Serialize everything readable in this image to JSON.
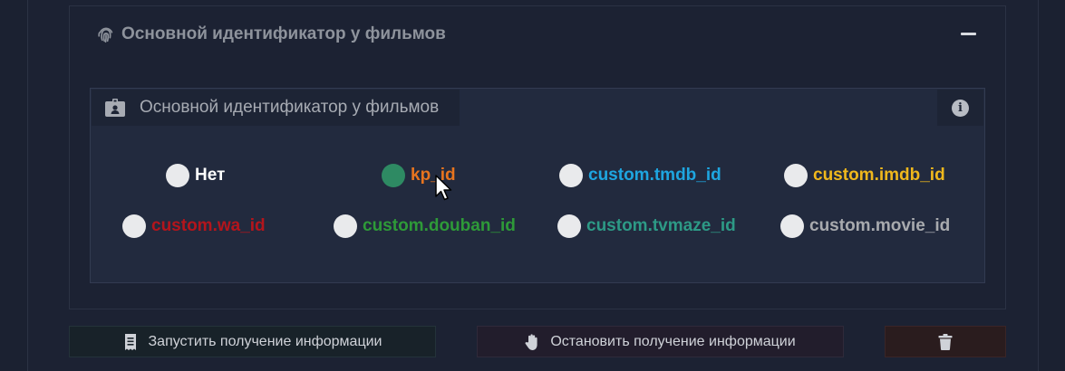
{
  "section": {
    "title": "Основной идентификатор у фильмов"
  },
  "panel": {
    "title": "Основной идентификатор у фильмов",
    "info_icon": "i"
  },
  "options": [
    {
      "label": "Нет",
      "color": "#ffffff",
      "checked": false
    },
    {
      "label": "kp_id",
      "color": "#e8741e",
      "checked": true
    },
    {
      "label": "custom.tmdb_id",
      "color": "#1ea6e0",
      "checked": false
    },
    {
      "label": "custom.imdb_id",
      "color": "#f0b81c",
      "checked": false
    },
    {
      "label": "custom.wa_id",
      "color": "#b3151c",
      "checked": false
    },
    {
      "label": "custom.douban_id",
      "color": "#2e9a38",
      "checked": false
    },
    {
      "label": "custom.tvmaze_id",
      "color": "#2d9a86",
      "checked": false
    },
    {
      "label": "custom.movie_id",
      "color": "#a8aaae",
      "checked": false
    }
  ],
  "buttons": {
    "start_label": "Запустить получение информации",
    "stop_label": "Остановить получение информации"
  },
  "icons": {
    "section": "fingerprint-icon",
    "panel": "id-badge-icon",
    "info": "info-icon",
    "collapse": "minus-icon",
    "start": "receipt-icon",
    "stop": "hand-icon",
    "delete": "trash-icon"
  }
}
